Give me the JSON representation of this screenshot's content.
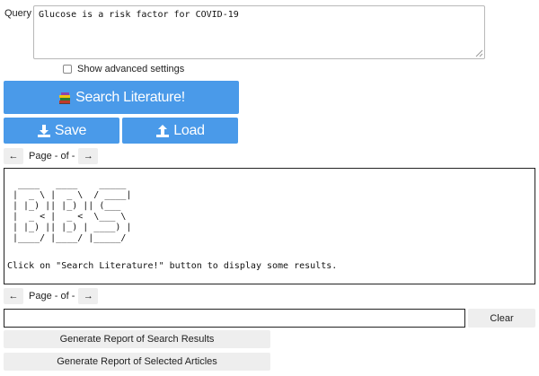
{
  "query": {
    "label": "Query",
    "value": "Glucose is a risk factor for COVID-19"
  },
  "advanced_settings": {
    "label": "Show advanced settings",
    "checked": false
  },
  "buttons": {
    "search": "Search Literature!",
    "save": "Save",
    "load": "Load",
    "clear": "Clear",
    "report_search": "Generate Report of Search Results",
    "report_selected": "Generate Report of Selected Articles"
  },
  "pager": {
    "prev": "←",
    "next": "→",
    "text": "Page - of -"
  },
  "results": {
    "logo": " ____   ____    _____\n|  _ \\ |  _ \\  / ____|\n| |_) || |_) || (___\n|  _ < |  _ <  \\___ \\\n| |_) || |_) | ____) |\n|____/ |____/ |_____/",
    "message": "Click on \"Search Literature!\" button to display some results."
  },
  "filter": {
    "value": ""
  },
  "colors": {
    "primary": "#4a9ae9",
    "secondary_button": "#eeeeee"
  },
  "icons": {
    "search": "books-icon",
    "save": "download-icon",
    "load": "upload-icon"
  }
}
